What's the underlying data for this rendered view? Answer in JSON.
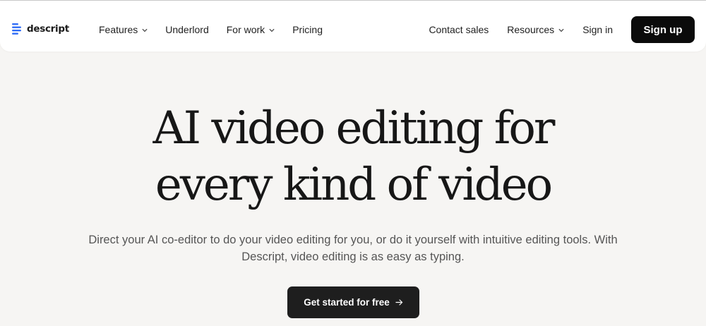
{
  "brand": {
    "name": "descript",
    "logo_icon": "descript-logo-icon",
    "accent": "#2f6cf6"
  },
  "nav": {
    "left": [
      {
        "label": "Features",
        "dropdown": true
      },
      {
        "label": "Underlord",
        "dropdown": false
      },
      {
        "label": "For work",
        "dropdown": true
      },
      {
        "label": "Pricing",
        "dropdown": false
      }
    ],
    "right": [
      {
        "label": "Contact sales",
        "dropdown": false
      },
      {
        "label": "Resources",
        "dropdown": true
      },
      {
        "label": "Sign in",
        "dropdown": false
      }
    ],
    "signup_label": "Sign up"
  },
  "hero": {
    "headline_line1": "AI video editing for",
    "headline_line2": "every kind of video",
    "subtitle_line1": "Direct your AI co-editor to do your video editing for you, or do it yourself with intuitive editing tools. With",
    "subtitle_line2": "Descript, video editing is as easy as typing.",
    "cta_label": "Get started for free",
    "cta_icon": "arrow-right-icon"
  },
  "colors": {
    "page_background": "#f6f5f3",
    "nav_background": "#ffffff",
    "button_dark": "#0b0b0b"
  }
}
